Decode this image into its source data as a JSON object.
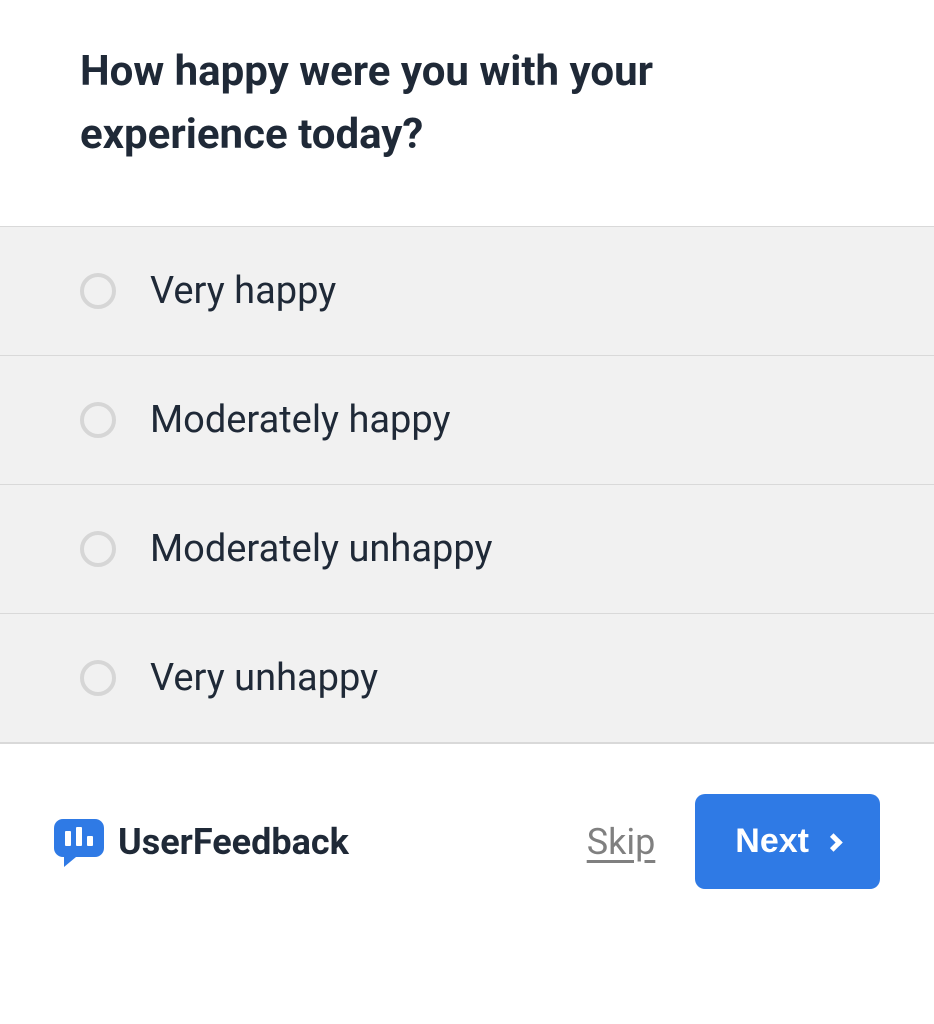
{
  "question": {
    "title": "How happy were you with your experience today?"
  },
  "options": [
    {
      "label": "Very happy"
    },
    {
      "label": "Moderately happy"
    },
    {
      "label": "Moderately unhappy"
    },
    {
      "label": "Very unhappy"
    }
  ],
  "footer": {
    "brand": "UserFeedback",
    "skip_label": "Skip",
    "next_label": "Next"
  }
}
